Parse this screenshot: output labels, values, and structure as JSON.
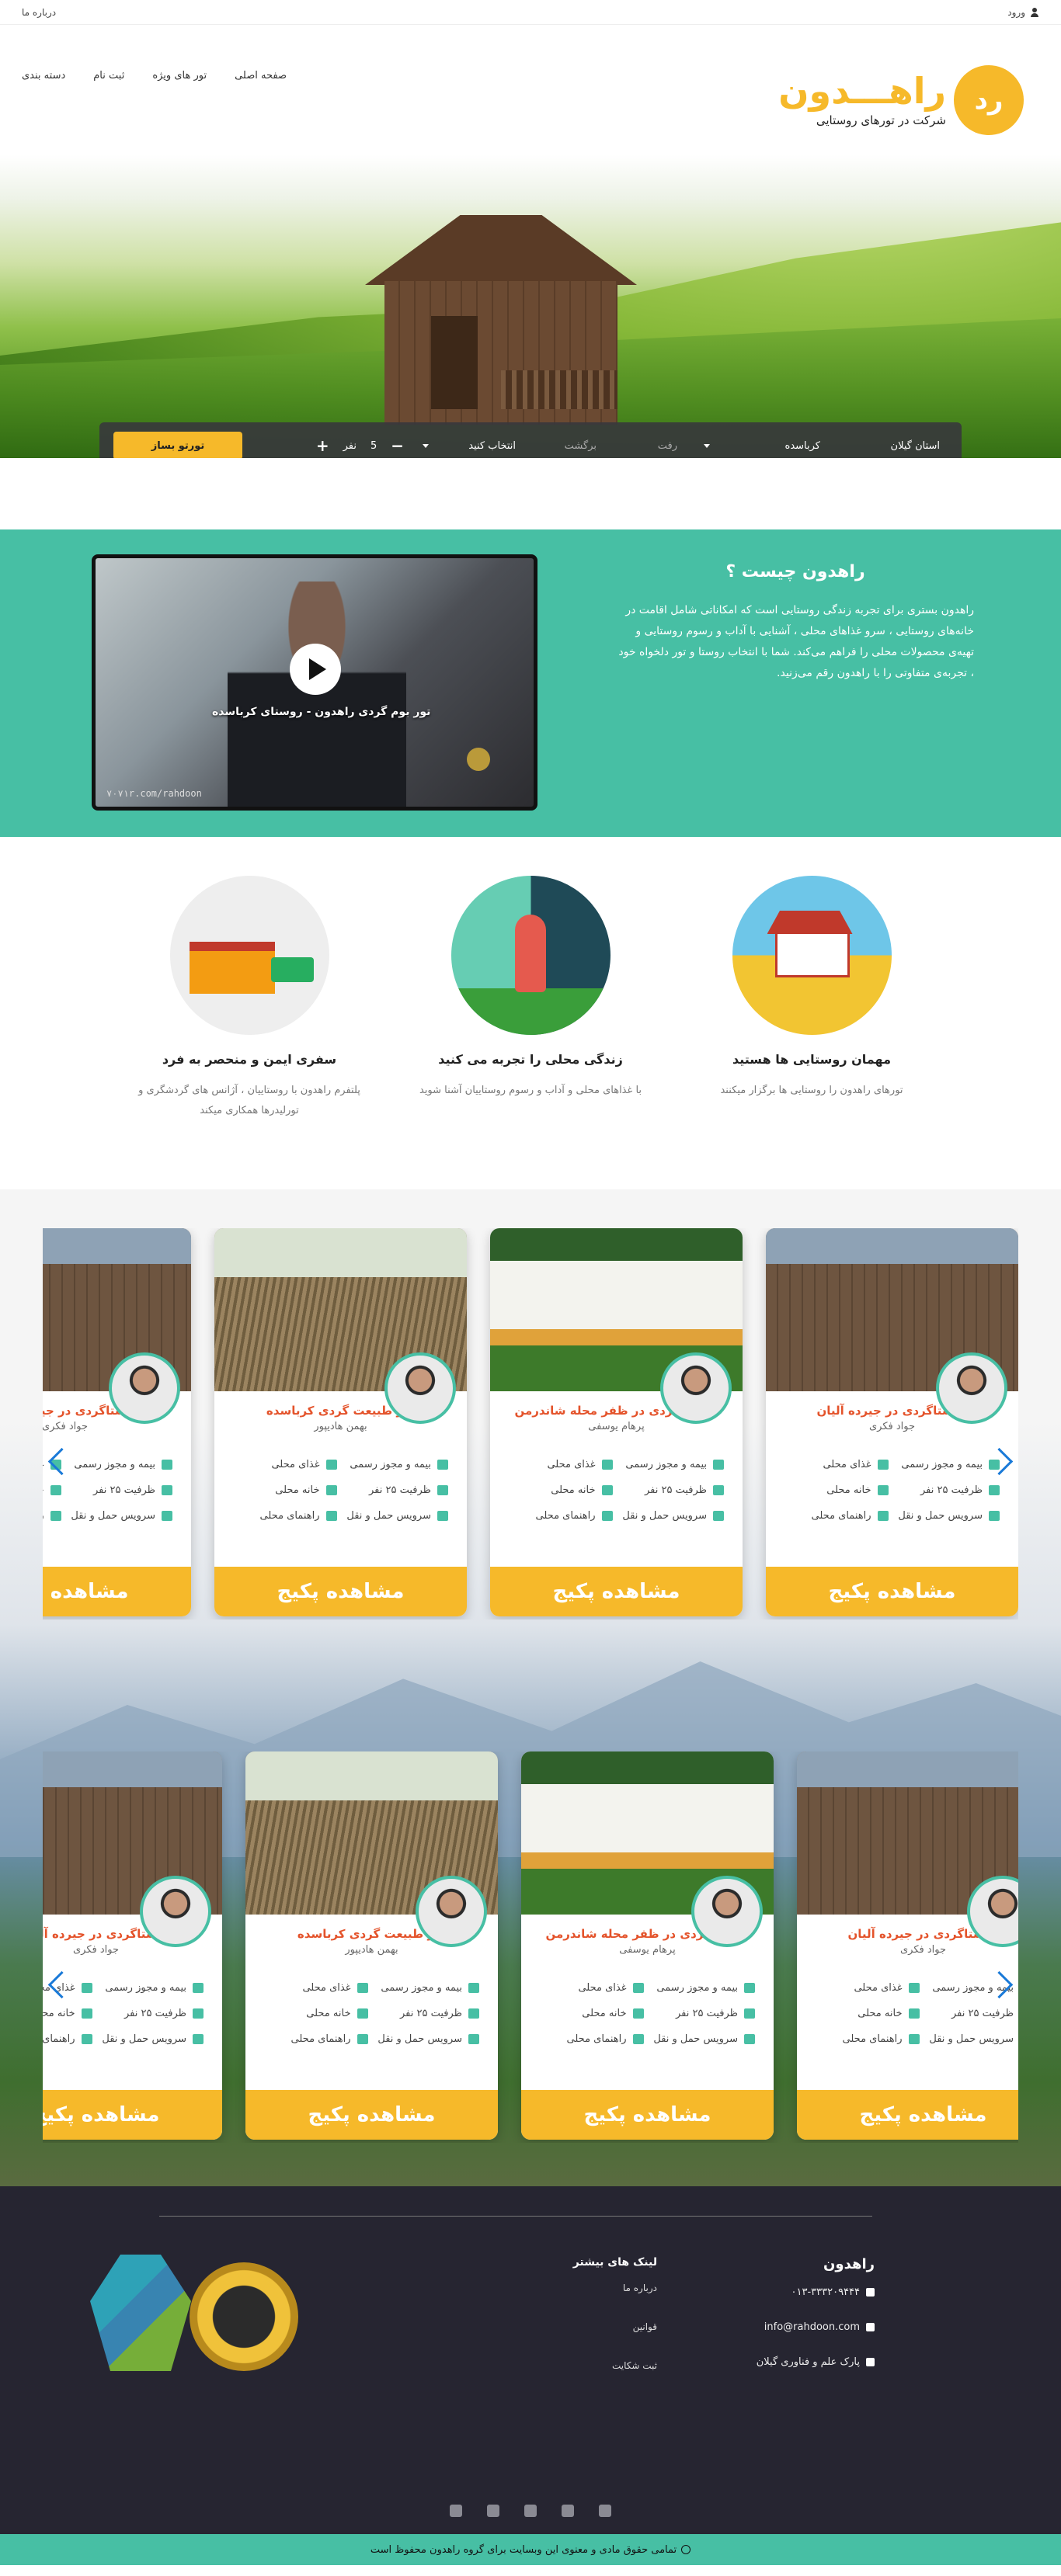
{
  "topbar": {
    "login": "ورود",
    "about": "درباره ما"
  },
  "brand": {
    "name": "راهـــدون",
    "tagline": "شرکت در تورهای روستایی",
    "mark": "رد"
  },
  "nav": [
    "صفحه اصلی",
    "تور های ویژه",
    "ثبت نام",
    "دسته بندی"
  ],
  "search": {
    "province": "استان گیلان",
    "city": "کرباسده",
    "departure": "رفت",
    "return": "برگشت",
    "category": "انتخاب کنید",
    "count": "5",
    "count_unit": "نفر",
    "plus": "+",
    "minus": "−",
    "build": "تورتو بساز"
  },
  "about": {
    "title": "راهدون چیست ؟",
    "body": "راهدون بستری برای تجربه زندگی روستایی است که امکاناتی شامل اقامت در خانه‌های روستایی ، سرو غذاهای محلی ، آشنایی با آداب و رسوم روستایی و تهیه‌ی محصولات محلی را فراهم می‌کند. شما با انتخاب روستا و تور دلخواه خود ، تجربه‌ی متفاوتی را با راهدون رقم می‌زنید.",
    "video_caption": "تور بوم گردی راهدون - روستای کرباسده",
    "video_watermark": "۷۰۷۱r.com/rahdoon"
  },
  "features": [
    {
      "art": "village-art",
      "title": "مهمان روستایی ها هستید",
      "desc": "تورهای راهدون را روستایی ها برگزار میکنند"
    },
    {
      "art": "hiker-art",
      "title": "زندگی محلی را تجربه می کنید",
      "desc": "با غذاهای محلی و آداب و رسوم روستاییان آشنا شوید"
    },
    {
      "art": "bus-art",
      "title": "سفری ایمن و منحصر به فرد",
      "desc": "پلتفرم راهدون با روستاییان ، آژانس های گردشگری و تورلیدرها همکاری میکند"
    }
  ],
  "package_button": "مشاهده پکیج",
  "amenities": {
    "food": "غذای محلی",
    "insurance": "بیمه و مجوز رسمی",
    "house": "خانه محلی",
    "capacity": "ظرفیت ۲۵ نفر",
    "guide": "راهنمای محلی",
    "transport": "سرویس حمل و نقل"
  },
  "packages_row1": [
    {
      "title": "روستاگردی در جیرده آلیان",
      "guide": "جواد فکری",
      "photo": "hut"
    },
    {
      "title": "روستا گردی در ظفر محله شاندرمن",
      "guide": "پرهام یوسفی",
      "photo": "house"
    },
    {
      "title": "تور طبیعت گردی کرباسده",
      "guide": "بهمن هادیپور",
      "photo": "fence"
    },
    {
      "title": "روستاگردی در جیرده آلیان",
      "guide": "جواد فکری",
      "photo": "hut"
    }
  ],
  "packages_row2": [
    {
      "title": "روستاگردی در جیرده آلیان",
      "guide": "جواد فکری",
      "photo": "hut"
    },
    {
      "title": "روستا گردی در ظفر محله شاندرمن",
      "guide": "پرهام یوسفی",
      "photo": "house"
    },
    {
      "title": "تور طبیعت گردی کرباسده",
      "guide": "بهمن هادیپور",
      "photo": "fence"
    },
    {
      "title": "روستاگردی در جیرده آلیان",
      "guide": "جواد فکری",
      "photo": "hut"
    }
  ],
  "footer": {
    "brand": "راهدون",
    "phone": "۰۱۳-۳۳۳۲۰۹۴۴۴",
    "email": "info@rahdoon.com",
    "address": "پارک علم و فناوری گیلان",
    "links_title": "لینک های بیشتر",
    "links": [
      "درباره ما",
      "قوانین",
      "ثبت شکایت"
    ],
    "copyright": "تمامی حقوق مادی و معنوی این وبسایت برای گروه راهدون محفوظ است"
  },
  "colors": {
    "accent": "#47bfa4",
    "brand": "#f6b92a",
    "footer": "#262531",
    "title_red": "#e4532b",
    "arrow": "#1a7ad8"
  }
}
